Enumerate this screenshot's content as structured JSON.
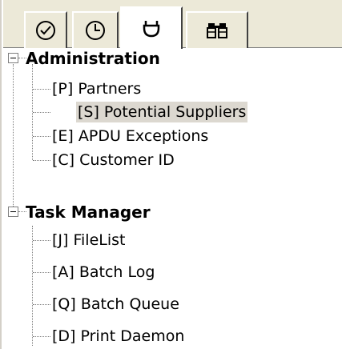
{
  "tabs": [
    {
      "icon": "clock-check-icon",
      "active": false
    },
    {
      "icon": "clock-icon",
      "active": false
    },
    {
      "icon": "plug-icon",
      "active": true
    },
    {
      "icon": "binoculars-icon",
      "active": false
    }
  ],
  "tree": [
    {
      "label": "Administration",
      "expanded": true,
      "children": [
        {
          "label": "[P] Partners",
          "selected": false
        },
        {
          "label": "[S] Potential Suppliers",
          "selected": true
        },
        {
          "label": "[E] APDU Exceptions",
          "selected": false
        },
        {
          "label": "[C] Customer ID",
          "selected": false
        }
      ]
    },
    {
      "label": "Task Manager",
      "expanded": true,
      "children": [
        {
          "label": "[J] FileList",
          "selected": false
        },
        {
          "label": "[A] Batch Log",
          "selected": false
        },
        {
          "label": "[Q] Batch Queue",
          "selected": false
        },
        {
          "label": "[D] Print Daemon",
          "selected": false
        }
      ]
    }
  ]
}
